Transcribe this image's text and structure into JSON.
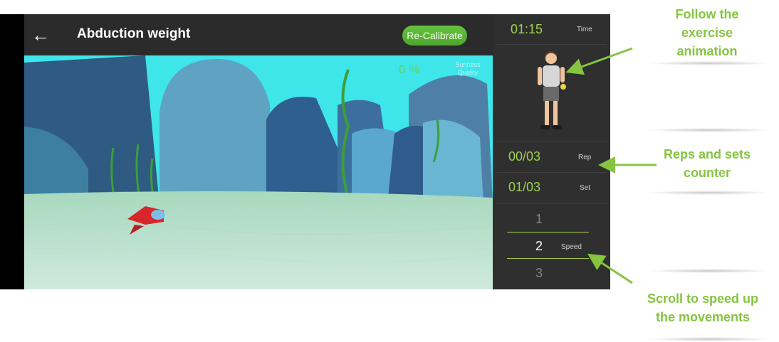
{
  "header": {
    "title": "Abduction weight",
    "recalibrate_label": "Re-Calibrate"
  },
  "icons": {
    "back": "arrow-left-icon"
  },
  "scene": {
    "quality_percent": "0 %",
    "quality_label": "Sunness Quality"
  },
  "panel": {
    "time_value": "01:15",
    "time_label": "Time",
    "rep_value": "00/03",
    "rep_label": "Rep",
    "set_value": "01/03",
    "set_label": "Set",
    "speed_options": [
      "1",
      "2",
      "3"
    ],
    "speed_selected": "2",
    "speed_label": "Speed"
  },
  "annotations": {
    "follow": [
      "Follow the",
      "exercise",
      "animation"
    ],
    "reps": [
      "Reps and sets",
      "counter"
    ],
    "scroll": [
      "Scroll to speed up",
      "the movements"
    ]
  },
  "colors": {
    "accent_green": "#86c440",
    "panel_bg": "#2f2f2f",
    "counter_green": "#9ccf4f"
  }
}
